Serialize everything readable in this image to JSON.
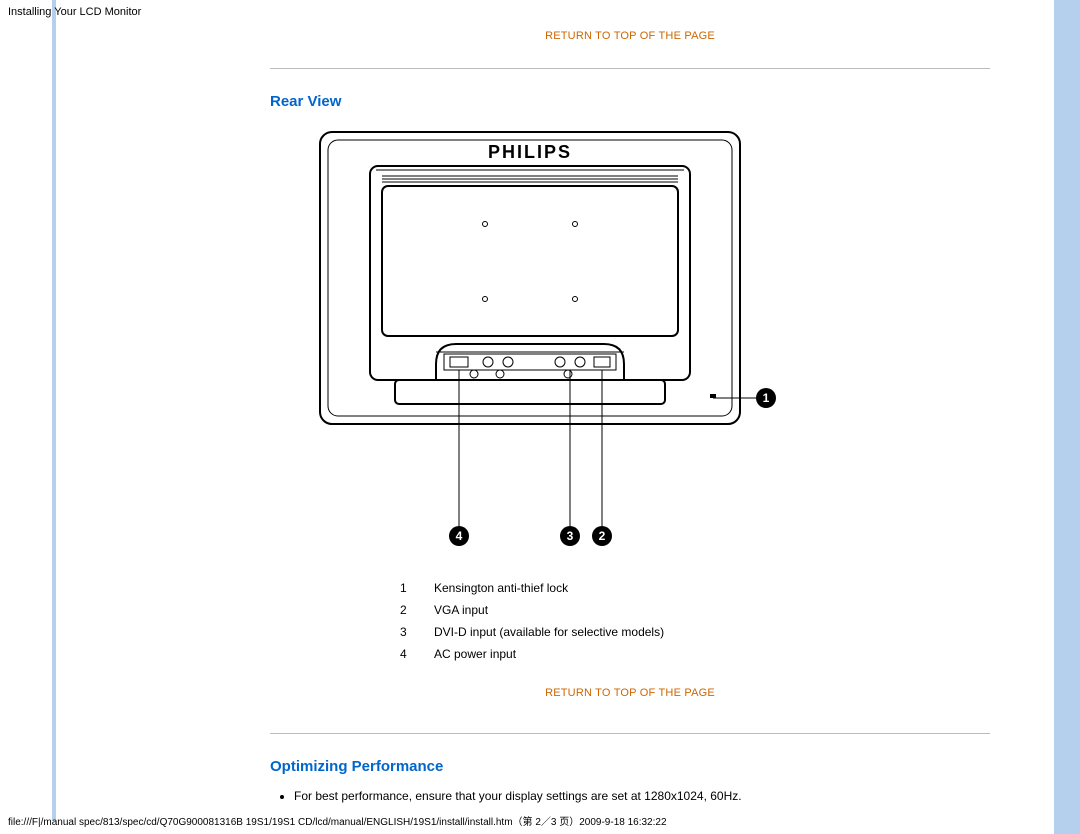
{
  "header_title": "Installing Your LCD Monitor",
  "links": {
    "return_top": "RETURN TO TOP OF THE PAGE"
  },
  "sections": {
    "rear_view": {
      "heading": "Rear View",
      "brand": "PHILIPS",
      "callouts": {
        "c1": "1",
        "c2": "2",
        "c3": "3",
        "c4": "4"
      },
      "legend": [
        {
          "num": "1",
          "text": "Kensington anti-thief lock"
        },
        {
          "num": "2",
          "text": "VGA input"
        },
        {
          "num": "3",
          "text": "DVI-D input (available for selective models)"
        },
        {
          "num": "4",
          "text": "AC power input"
        }
      ]
    },
    "optimizing": {
      "heading": "Optimizing Performance",
      "bullets": [
        "For best performance, ensure that your display settings are set at 1280x1024, 60Hz."
      ]
    }
  },
  "footer": "file:///F|/manual spec/813/spec/cd/Q70G900081316B 19S1/19S1 CD/lcd/manual/ENGLISH/19S1/install/install.htm（第 2／3 页）2009-9-18 16:32:22"
}
